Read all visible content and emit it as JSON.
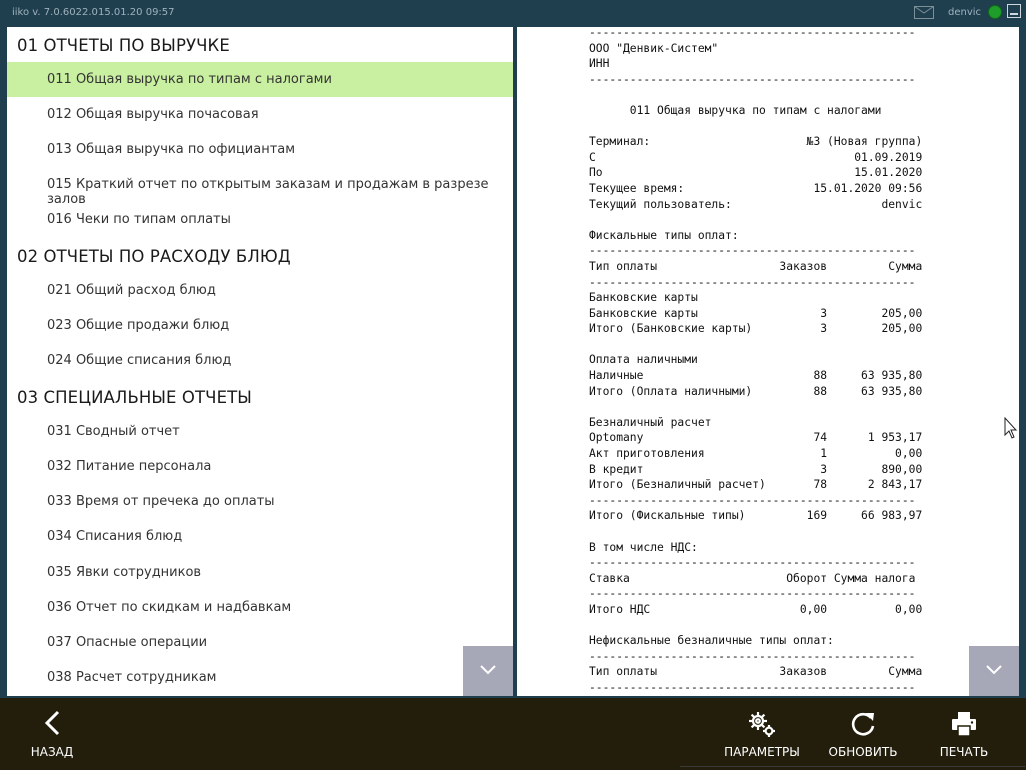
{
  "topbar": {
    "app_version": "iiko  v. 7.0.6022.0",
    "datetime": "15.01.20    09:57",
    "user": "denvic",
    "status_color": "#1e9d2a"
  },
  "sections": [
    {
      "title": "01 ОТЧЕТЫ ПО ВЫРУЧКЕ",
      "items": [
        "011 Общая выручка по типам с налогами",
        "012 Общая выручка почасовая",
        "013 Общая выручка по официантам",
        "015 Краткий отчет по открытым заказам и продажам в разрезе залов",
        "016 Чеки по типам оплаты"
      ]
    },
    {
      "title": "02 ОТЧЕТЫ ПО РАСХОДУ БЛЮД",
      "items": [
        "021 Общий расход блюд",
        "023 Общие продажи блюд",
        "024 Общие списания блюд"
      ]
    },
    {
      "title": "03 СПЕЦИАЛЬНЫЕ ОТЧЕТЫ",
      "items": [
        "031 Сводный отчет",
        "032 Питание персонала",
        "033 Время от пречека до оплаты",
        "034 Списания блюд",
        "035 Явки сотрудников",
        "036 Отчет по скидкам и надбавкам",
        "037 Опасные операции",
        "038 Расчет сотрудникам"
      ]
    }
  ],
  "selected_item": "011 Общая выручка по типам с налогами",
  "selected_color": "#c9f0a0",
  "report_lines": [
    "------------------------------------------------",
    "ООО \"Денвик-Систем\"",
    "ИНН",
    "------------------------------------------------",
    "",
    "      011 Общая выручка по типам с налогами",
    "",
    "Терминал:                       №3 (Новая группа)",
    "С                                      01.09.2019",
    "По                                     15.01.2020",
    "Текущее время:                   15.01.2020 09:56",
    "Текущий пользователь:                      denvic",
    "",
    "Фискальные типы оплат:",
    "------------------------------------------------",
    "Тип оплаты                  Заказов         Сумма",
    "------------------------------------------------",
    "Банковские карты",
    "Банковские карты                  3        205,00",
    "Итого (Банковские карты)          3        205,00",
    "",
    "Оплата наличными",
    "Наличные                         88     63 935,80",
    "Итого (Оплата наличными)         88     63 935,80",
    "",
    "Безналичный расчет",
    "Optomany                         74      1 953,17",
    "Акт приготовления                 1          0,00",
    "В кредит                          3        890,00",
    "Итого (Безналичный расчет)       78      2 843,17",
    "------------------------------------------------",
    "Итого (Фискальные типы)         169     66 983,97",
    "",
    "В том числе НДС:",
    "------------------------------------------------",
    "Ставка                       Оборот Сумма налога",
    "------------------------------------------------",
    "Итого НДС                      0,00          0,00",
    "",
    "Нефискальные безналичные типы оплат:",
    "------------------------------------------------",
    "Тип оплаты                  Заказов         Сумма",
    "------------------------------------------------"
  ],
  "bottombar": {
    "back": "НАЗАД",
    "params": "ПАРАМЕТРЫ",
    "refresh": "ОБНОВИТЬ",
    "print": "ПЕЧАТЬ"
  },
  "icons": {
    "mail": "mail-icon",
    "back": "chevron-left-icon",
    "params": "gears-icon",
    "refresh": "refresh-icon",
    "print": "printer-icon",
    "scroll_down": "chevron-down-icon"
  }
}
